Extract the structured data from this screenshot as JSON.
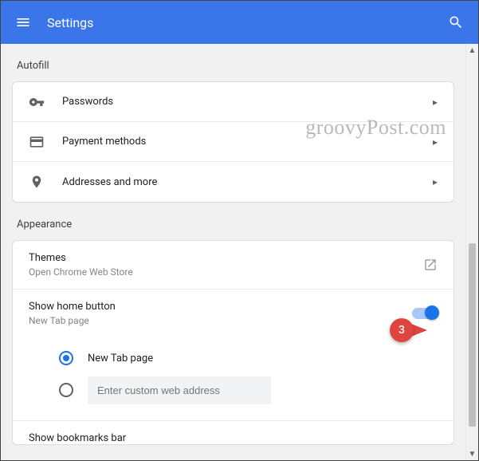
{
  "appbar": {
    "title": "Settings"
  },
  "sections": {
    "autofill": {
      "title": "Autofill",
      "items": [
        {
          "label": "Passwords"
        },
        {
          "label": "Payment methods"
        },
        {
          "label": "Addresses and more"
        }
      ]
    },
    "appearance": {
      "title": "Appearance",
      "themes": {
        "label": "Themes",
        "sub": "Open Chrome Web Store"
      },
      "home_button": {
        "label": "Show home button",
        "sub": "New Tab page",
        "toggle_on": true,
        "options": {
          "new_tab": "New Tab page",
          "custom_placeholder": "Enter custom web address"
        }
      },
      "bookmarks_bar": {
        "label": "Show bookmarks bar"
      }
    }
  },
  "watermark": "groovyPost.com",
  "annotation": {
    "number": "3"
  }
}
